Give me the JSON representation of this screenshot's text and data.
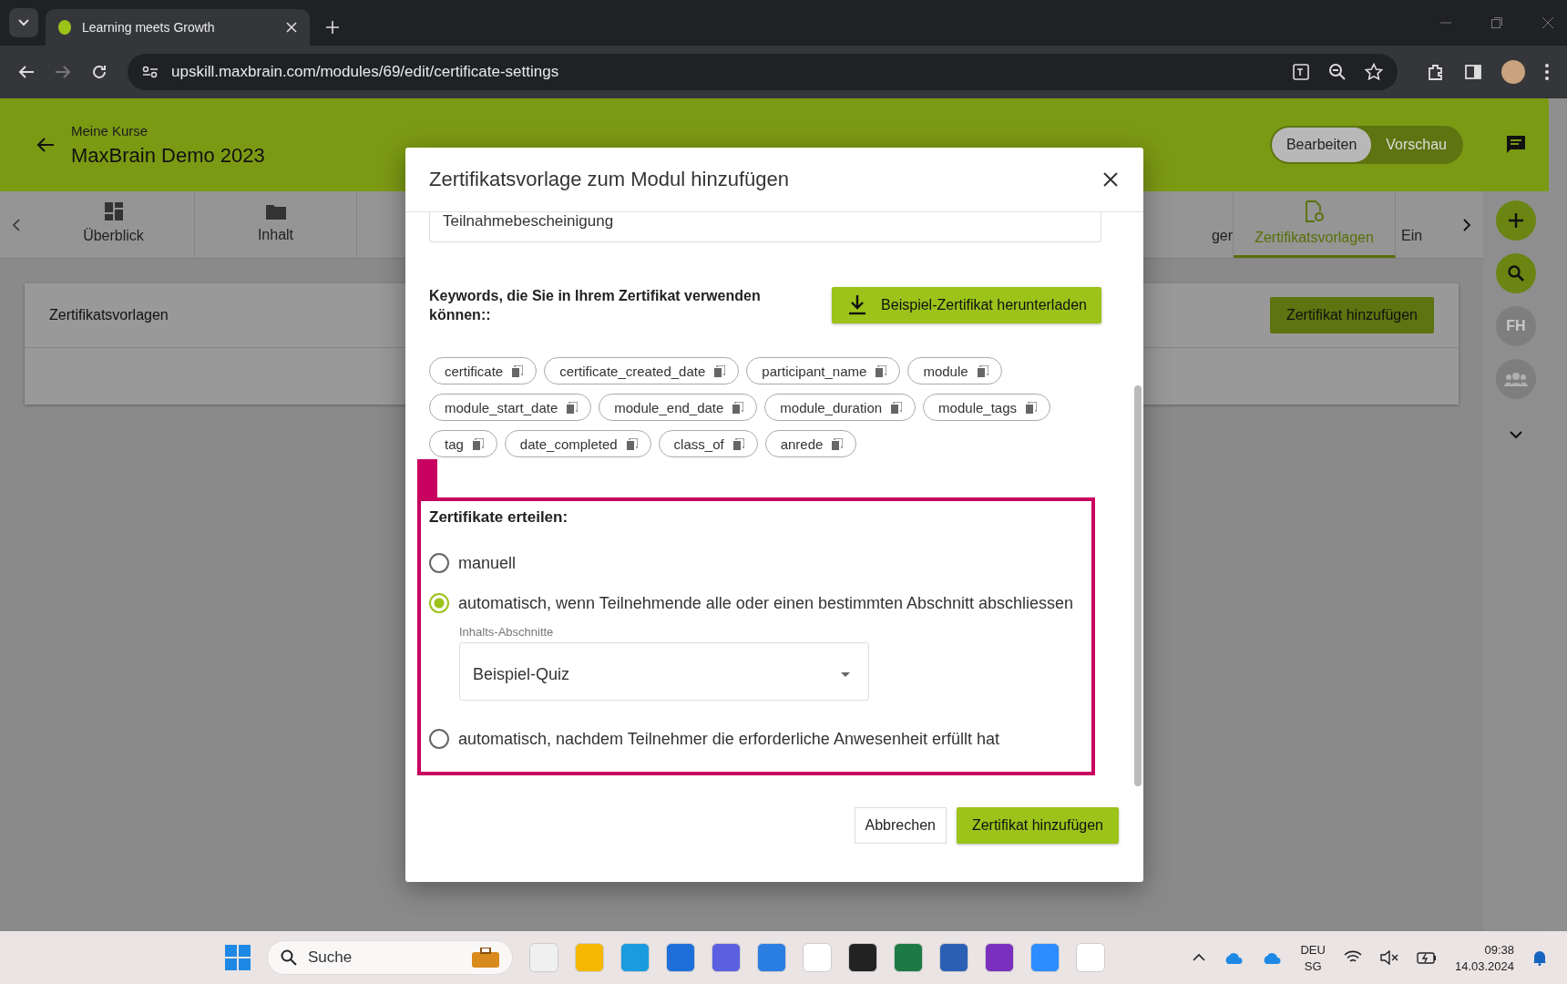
{
  "browser": {
    "tab_title": "Learning meets Growth",
    "url": "upskill.maxbrain.com/modules/69/edit/certificate-settings"
  },
  "header": {
    "breadcrumb": "Meine Kurse",
    "title": "MaxBrain Demo 2023",
    "mode_toggle": [
      {
        "label": "Bearbeiten",
        "selected": true
      },
      {
        "label": "Vorschau",
        "selected": false
      }
    ]
  },
  "tabs_left": [
    {
      "label": "Überblick",
      "selected": false,
      "kind": "dashboard"
    },
    {
      "label": "Inhalt",
      "selected": false,
      "kind": "folder"
    }
  ],
  "tabs_right": [
    {
      "label": "ger",
      "selected": false,
      "kind": "plain"
    },
    {
      "label": "Zertifikatsvorlagen",
      "selected": true,
      "kind": "certificate"
    },
    {
      "label": "Ein",
      "selected": false,
      "kind": "plain"
    }
  ],
  "card": {
    "title": "Zertifikatsvorlagen",
    "button": "Zertifikat hinzufügen"
  },
  "sidebar": {
    "avatar": "FH"
  },
  "modal": {
    "title": "Zertifikatsvorlage zum Modul hinzufügen",
    "name_value": "Teilnahmebescheinigung",
    "keywords_label": "Keywords, die Sie in Ihrem Zertifikat verwenden können::",
    "download_button": "Beispiel-Zertifikat herunterladen",
    "keywords": [
      "certificate",
      "certificate_created_date",
      "participant_name",
      "module",
      "module_start_date",
      "module_end_date",
      "module_duration",
      "module_tags",
      "tag",
      "date_completed",
      "class_of",
      "anrede"
    ],
    "issue_label": "Zertifikate erteilen:",
    "options": [
      {
        "label": "manuell",
        "selected": false,
        "kind": "plain"
      },
      {
        "label": "automatisch, wenn Teilnehmende alle oder einen bestimmten Abschnitt abschliessen",
        "selected": true,
        "kind": "section"
      },
      {
        "label": "automatisch, nachdem Teilnehmer die erforderliche Anwesenheit erfüllt hat",
        "selected": false,
        "kind": "plain"
      }
    ],
    "section_select": {
      "label": "Inhalts-Abschnitte",
      "value": "Beispiel-Quiz"
    },
    "cancel_button": "Abbrechen",
    "submit_button": "Zertifikat hinzufügen"
  },
  "taskbar": {
    "search_placeholder": "Suche",
    "language": "DEU",
    "region": "SG",
    "time": "09:38",
    "date": "14.03.2024"
  }
}
